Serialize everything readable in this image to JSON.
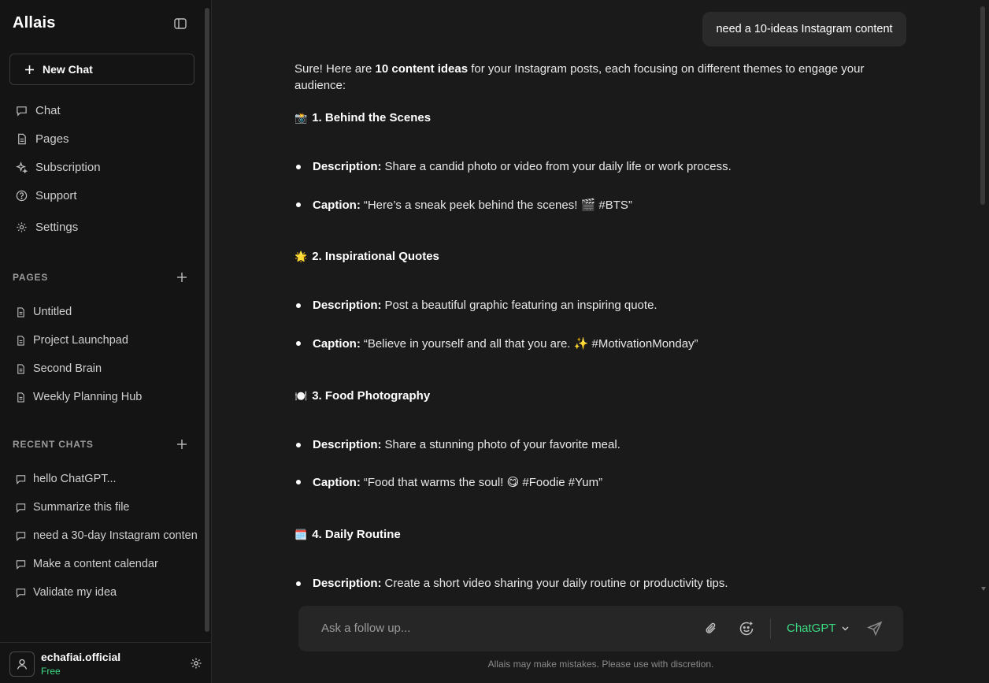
{
  "app": {
    "name": "Allais"
  },
  "sidebar": {
    "new_chat_label": "New Chat",
    "nav": [
      {
        "label": "Chat",
        "icon": "chat-bubble-icon"
      },
      {
        "label": "Pages",
        "icon": "document-icon"
      },
      {
        "label": "Subscription",
        "icon": "sparkle-icon"
      },
      {
        "label": "Support",
        "icon": "help-circle-icon"
      },
      {
        "label": "Settings",
        "icon": "gear-icon"
      }
    ],
    "pages_title": "PAGES",
    "pages": [
      "Untitled",
      "Project Launchpad",
      "Second Brain",
      "Weekly Planning Hub"
    ],
    "recent_title": "RECENT CHATS",
    "recent": [
      "hello ChatGPT...",
      "Summarize this file",
      "need a 30-day Instagram conten",
      "Make a content calendar",
      "Validate my idea"
    ]
  },
  "user": {
    "name": "echafiai.official",
    "plan": "Free"
  },
  "chat": {
    "user_message": "need a 10-ideas Instagram content",
    "intro_prefix": "Sure! Here are ",
    "intro_bold": "10 content ideas",
    "intro_suffix": " for your Instagram posts, each focusing on different themes to engage your audience:",
    "sections": [
      {
        "emoji": "📸",
        "title": "1. Behind the Scenes",
        "desc_label": "Description:",
        "desc": "Share a candid photo or video from your daily life or work process.",
        "cap_label": "Caption:",
        "cap": "“Here’s a sneak peek behind the scenes! 🎬 #BTS”"
      },
      {
        "emoji": "🌟",
        "title": "2. Inspirational Quotes",
        "desc_label": "Description:",
        "desc": "Post a beautiful graphic featuring an inspiring quote.",
        "cap_label": "Caption:",
        "cap": "“Believe in yourself and all that you are. ✨ #MotivationMonday”"
      },
      {
        "emoji": "🍽️",
        "title": "3. Food Photography",
        "desc_label": "Description:",
        "desc": "Share a stunning photo of your favorite meal.",
        "cap_label": "Caption:",
        "cap": "“Food that warms the soul! 😋 #Foodie #Yum”"
      },
      {
        "emoji": "🗓️",
        "title": "4. Daily Routine",
        "desc_label": "Description:",
        "desc": "Create a short video sharing your daily routine or productivity tips."
      }
    ]
  },
  "composer": {
    "placeholder": "Ask a follow up...",
    "model": "ChatGPT",
    "disclaimer": "Allais may make mistakes. Please use with discretion."
  },
  "colors": {
    "accent": "#3ddc84",
    "bg": "#1a1a1a",
    "sidebar": "#141414"
  }
}
